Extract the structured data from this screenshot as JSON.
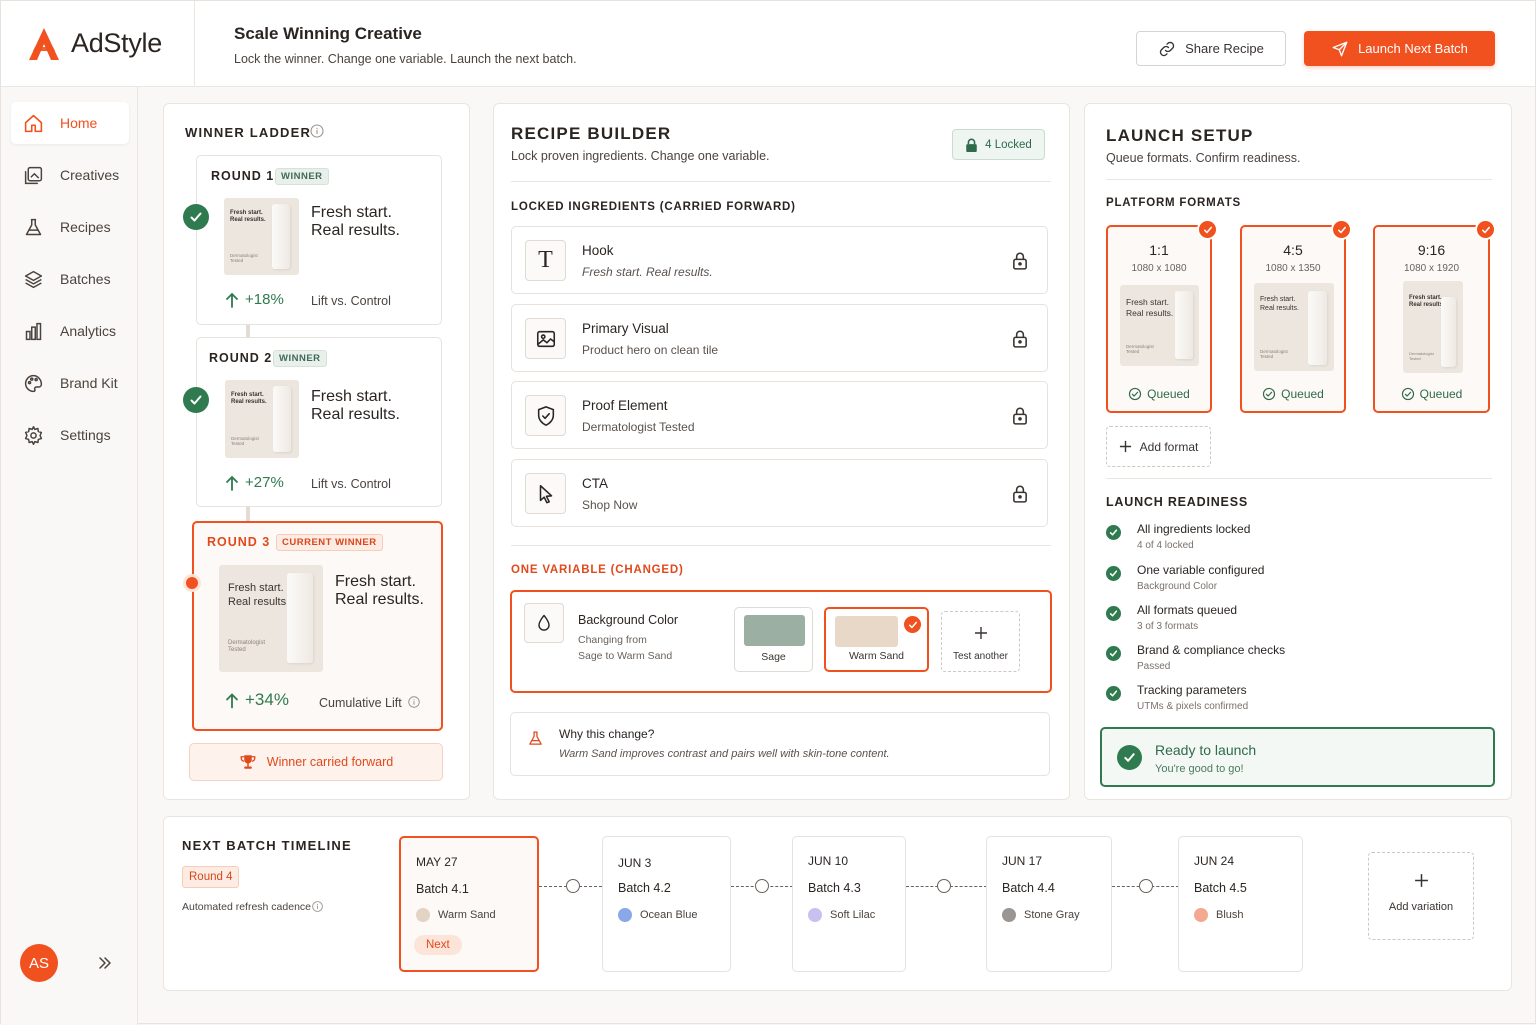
{
  "brand": {
    "name": "AdStyle",
    "accent": "#f1501f"
  },
  "header": {
    "title": "Scale Winning Creative",
    "subtitle": "Lock the winner. Change one variable. Launch the next batch.",
    "share_label": "Share Recipe",
    "launch_label": "Launch Next Batch"
  },
  "sidebar": {
    "items": [
      {
        "label": "Home",
        "icon": "home-icon",
        "active": true
      },
      {
        "label": "Creatives",
        "icon": "gallery-icon"
      },
      {
        "label": "Recipes",
        "icon": "flask-icon"
      },
      {
        "label": "Batches",
        "icon": "layers-icon"
      },
      {
        "label": "Analytics",
        "icon": "bar-chart-icon"
      },
      {
        "label": "Brand Kit",
        "icon": "palette-icon"
      },
      {
        "label": "Settings",
        "icon": "gear-icon"
      }
    ],
    "avatar": "AS"
  },
  "ladder": {
    "title": "WINNER LADDER",
    "rounds": [
      {
        "label": "ROUND 1",
        "badge": "WINNER",
        "thumb_text": "Fresh start.\nReal results.",
        "thumb_small": "Dermatologist\nTested",
        "headline": "Fresh start.\nReal results.",
        "lift": "+18%",
        "lift_label": "Lift vs. Control"
      },
      {
        "label": "ROUND 2",
        "badge": "WINNER",
        "thumb_text": "Fresh start.\nReal results.",
        "thumb_small": "Dermatologist\nTested",
        "headline": "Fresh start.\nReal results.",
        "lift": "+27%",
        "lift_label": "Lift vs. Control"
      },
      {
        "label": "ROUND 3",
        "badge": "CURRENT WINNER",
        "thumb_text": "Fresh start.\nReal results.",
        "thumb_small": "Dermatologist\nTested",
        "headline": "Fresh start.\nReal results.",
        "lift": "+34%",
        "lift_label": "Cumulative Lift"
      }
    ],
    "carried": "Winner carried forward"
  },
  "recipe": {
    "title": "RECIPE BUILDER",
    "subtitle": "Lock proven ingredients. Change one variable.",
    "locked_count": "4 Locked",
    "locked_heading": "LOCKED INGREDIENTS (CARRIED FORWARD)",
    "ingredients": [
      {
        "title": "Hook",
        "value": "Fresh start. Real results.",
        "icon": "text-icon"
      },
      {
        "title": "Primary Visual",
        "value": "Product hero on clean tile",
        "icon": "image-icon"
      },
      {
        "title": "Proof Element",
        "value": "Dermatologist Tested",
        "icon": "shield-check-icon"
      },
      {
        "title": "CTA",
        "value": "Shop Now",
        "icon": "cursor-icon"
      }
    ],
    "variable_heading": "ONE VARIABLE (CHANGED)",
    "variable": {
      "title": "Background Color",
      "desc1": "Changing from",
      "desc2": "Sage to Warm Sand",
      "options": [
        {
          "label": "Sage",
          "color": "#9cafa3"
        },
        {
          "label": "Warm Sand",
          "color": "#e8d8c8",
          "selected": true
        }
      ],
      "test_another": "Test another"
    },
    "why_title": "Why this change?",
    "why_text": "Warm Sand improves contrast and pairs well with skin-tone content."
  },
  "launch": {
    "title": "LAUNCH SETUP",
    "subtitle": "Queue formats. Confirm readiness.",
    "formats_heading": "PLATFORM FORMATS",
    "formats": [
      {
        "ratio": "1:1",
        "dims": "1080 x 1080",
        "status": "Queued",
        "thumb_text": "Fresh start.\nReal results.",
        "thumb_small": "Dermatologist\nTested"
      },
      {
        "ratio": "4:5",
        "dims": "1080 x 1350",
        "status": "Queued",
        "thumb_text": "Fresh start.\nReal results.",
        "thumb_small": "Dermatologist\nTested"
      },
      {
        "ratio": "9:16",
        "dims": "1080 x 1920",
        "status": "Queued",
        "thumb_text": "Fresh start.\nReal results.",
        "thumb_small": "Dermatologist\nTested"
      }
    ],
    "add_format": "Add format",
    "readiness_heading": "LAUNCH READINESS",
    "readiness": [
      {
        "title": "All ingredients locked",
        "detail": "4 of 4 locked"
      },
      {
        "title": "One variable configured",
        "detail": "Background Color"
      },
      {
        "title": "All formats queued",
        "detail": "3 of 3 formats"
      },
      {
        "title": "Brand & compliance checks",
        "detail": "Passed"
      },
      {
        "title": "Tracking parameters",
        "detail": "UTMs & pixels confirmed"
      }
    ],
    "ready_title": "Ready to launch",
    "ready_sub": "You're good to go!"
  },
  "timeline": {
    "title": "NEXT BATCH TIMELINE",
    "round_badge": "Round 4",
    "cadence": "Automated refresh cadence",
    "batches": [
      {
        "date": "MAY 27",
        "batch": "Batch 4.1",
        "color_name": "Warm Sand",
        "color": "#e3d3c3",
        "tag": "Next"
      },
      {
        "date": "JUN 3",
        "batch": "Batch 4.2",
        "color_name": "Ocean Blue",
        "color": "#8aa8e8"
      },
      {
        "date": "JUN 10",
        "batch": "Batch 4.3",
        "color_name": "Soft Lilac",
        "color": "#c9c0f0"
      },
      {
        "date": "JUN 17",
        "batch": "Batch 4.4",
        "color_name": "Stone Gray",
        "color": "#9a9694"
      },
      {
        "date": "JUN 24",
        "batch": "Batch 4.5",
        "color_name": "Blush",
        "color": "#f3a98f"
      }
    ],
    "add_variation": "Add variation"
  }
}
